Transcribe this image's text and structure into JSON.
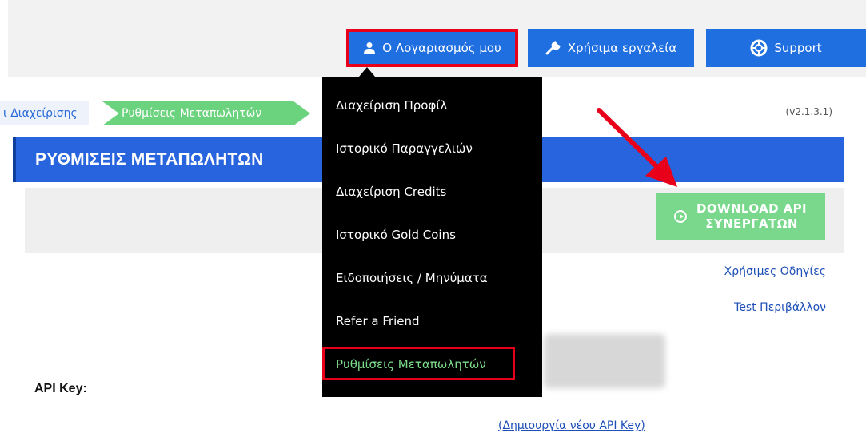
{
  "topbar": {
    "account_label": "Ο Λογαριασμός μου",
    "tools_label": "Χρήσιμα εργαλεία",
    "support_label": "Support"
  },
  "breadcrumb": {
    "prev": "ι Διαχείρισης",
    "current": "Ρυθμίσεις Μεταπωλητών"
  },
  "version": "(v2.1.3.1)",
  "page_title": "ΡΥΘΜΙΣΕΙΣ ΜΕΤΑΠΩΛΗΤΩΝ",
  "download": {
    "line1": "DOWNLOAD API",
    "line2": "ΣΥΝΕΡΓΑΤΩΝ"
  },
  "links": {
    "guides": "Χρήσιμες Οδηγίες",
    "test": "Test Περιβάλλον",
    "new_key": "(Δημιουργία νέου API Key)"
  },
  "api_key_label": "API Key:",
  "menu": {
    "items": [
      {
        "label": "Διαχείριση Προφίλ"
      },
      {
        "label": "Ιστορικό Παραγγελιών"
      },
      {
        "label": "Διαχείριση Credits"
      },
      {
        "label": "Ιστορικό Gold Coins"
      },
      {
        "label": "Ειδοποιήσεις / Μηνύματα"
      },
      {
        "label": "Refer a Friend"
      },
      {
        "label": "Ρυθμίσεις Μεταπωλητών"
      }
    ]
  },
  "colors": {
    "primary": "#1f6fe0",
    "highlight": "#e8001a",
    "green": "#79d88b",
    "menu_bg": "#000000"
  },
  "icons": {
    "account": "user-icon",
    "tools": "wrench-icon",
    "support": "lifebuoy-icon"
  }
}
